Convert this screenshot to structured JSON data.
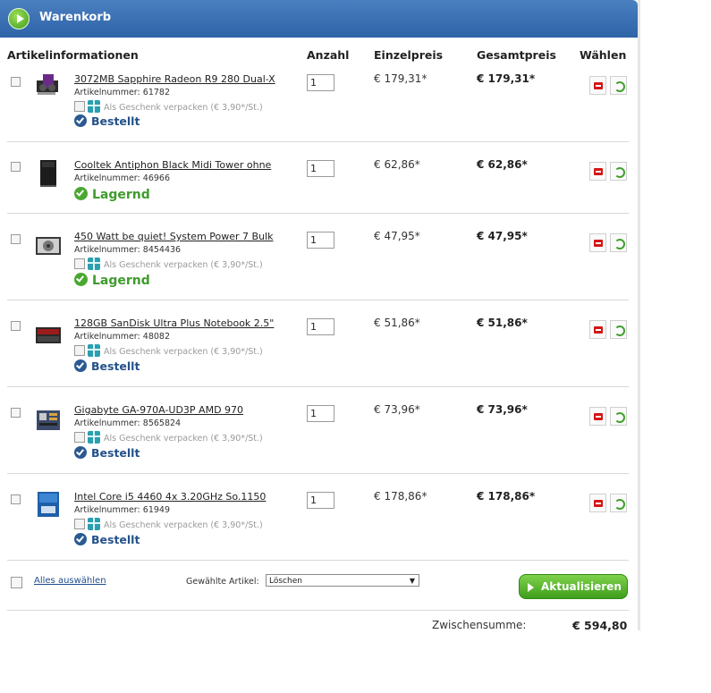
{
  "cart": {
    "title": "Warenkorb",
    "columns": {
      "info": "Artikelinformationen",
      "qty": "Anzahl",
      "unit": "Einzelpreis",
      "total": "Gesamtpreis",
      "choose": "Wählen"
    },
    "items": [
      {
        "name": "3072MB Sapphire Radeon R9 280 Dual-X",
        "article_label": "Artikelnummer:",
        "article_no": "61782",
        "gift": "Als Geschenk verpacken (€ 3,90*/St.)",
        "status": "Bestellt",
        "status_type": "bestellt",
        "qty": "1",
        "unit_price": "€ 179,31*",
        "total_price": "€ 179,31*",
        "thumb": "graphics-card-image"
      },
      {
        "name": "Cooltek Antiphon Black Midi Tower ohne",
        "article_label": "Artikelnummer:",
        "article_no": "46966",
        "gift": "",
        "status": "Lagernd",
        "status_type": "lagernd",
        "qty": "1",
        "unit_price": "€ 62,86*",
        "total_price": "€ 62,86*",
        "thumb": "pc-case-image"
      },
      {
        "name": "450 Watt be quiet! System Power 7 Bulk",
        "article_label": "Artikelnummer:",
        "article_no": "8454436",
        "gift": "Als Geschenk verpacken (€ 3,90*/St.)",
        "status": "Lagernd",
        "status_type": "lagernd",
        "qty": "1",
        "unit_price": "€ 47,95*",
        "total_price": "€ 47,95*",
        "thumb": "power-supply-image"
      },
      {
        "name": "128GB SanDisk Ultra Plus Notebook 2.5\"",
        "article_label": "Artikelnummer:",
        "article_no": "48082",
        "gift": "Als Geschenk verpacken (€ 3,90*/St.)",
        "status": "Bestellt",
        "status_type": "bestellt",
        "qty": "1",
        "unit_price": "€ 51,86*",
        "total_price": "€ 51,86*",
        "thumb": "ssd-image"
      },
      {
        "name": "Gigabyte GA-970A-UD3P AMD 970",
        "article_label": "Artikelnummer:",
        "article_no": "8565824",
        "gift": "Als Geschenk verpacken (€ 3,90*/St.)",
        "status": "Bestellt",
        "status_type": "bestellt",
        "qty": "1",
        "unit_price": "€ 73,96*",
        "total_price": "€ 73,96*",
        "thumb": "mainboard-image"
      },
      {
        "name": "Intel Core i5 4460 4x 3.20GHz So.1150",
        "article_label": "Artikelnummer:",
        "article_no": "61949",
        "gift": "Als Geschenk verpacken (€ 3,90*/St.)",
        "status": "Bestellt",
        "status_type": "bestellt",
        "qty": "1",
        "unit_price": "€ 178,86*",
        "total_price": "€ 178,86*",
        "thumb": "cpu-box-image"
      }
    ],
    "footer": {
      "select_all": "Alles auswählen",
      "selected_label": "Gewählte Artikel:",
      "selected_action": "Löschen",
      "update_button": "Aktualisieren"
    },
    "subtotal_label": "Zwischensumme:",
    "subtotal_value": "€ 594,80",
    "colors": {
      "header_blue": "#2e64a8",
      "bestellt": "#24518a",
      "lagernd": "#3f9b2d",
      "button_green": "#4fae27"
    }
  }
}
